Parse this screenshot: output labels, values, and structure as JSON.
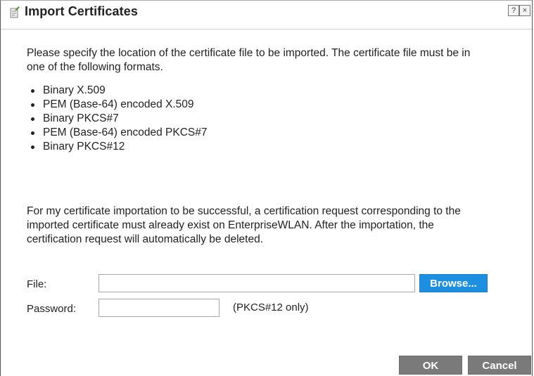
{
  "dialog": {
    "title": "Import Certificates",
    "help_label": "?",
    "close_label": "×"
  },
  "content": {
    "intro": "Please specify the location of the certificate file to be imported. The certificate file must be in one of the following formats.",
    "formats": [
      "Binary X.509",
      "PEM (Base-64) encoded X.509",
      "Binary PKCS#7",
      "PEM (Base-64) encoded PKCS#7",
      "Binary PKCS#12"
    ],
    "note": "For my certificate importation to be successful, a certification request corresponding to the imported certificate must already exist on EnterpriseWLAN. After the importation, the certification request will automatically be deleted."
  },
  "form": {
    "file_label": "File:",
    "file_value": "",
    "browse_label": "Browse...",
    "password_label": "Password:",
    "password_value": "",
    "pkcs_note": "(PKCS#12 only)"
  },
  "footer": {
    "ok_label": "OK",
    "cancel_label": "Cancel"
  },
  "colors": {
    "accent": "#1d8fe0",
    "button_gray": "#7a7a7a"
  },
  "icons": {
    "title_icon": "certificate-edit-icon"
  }
}
